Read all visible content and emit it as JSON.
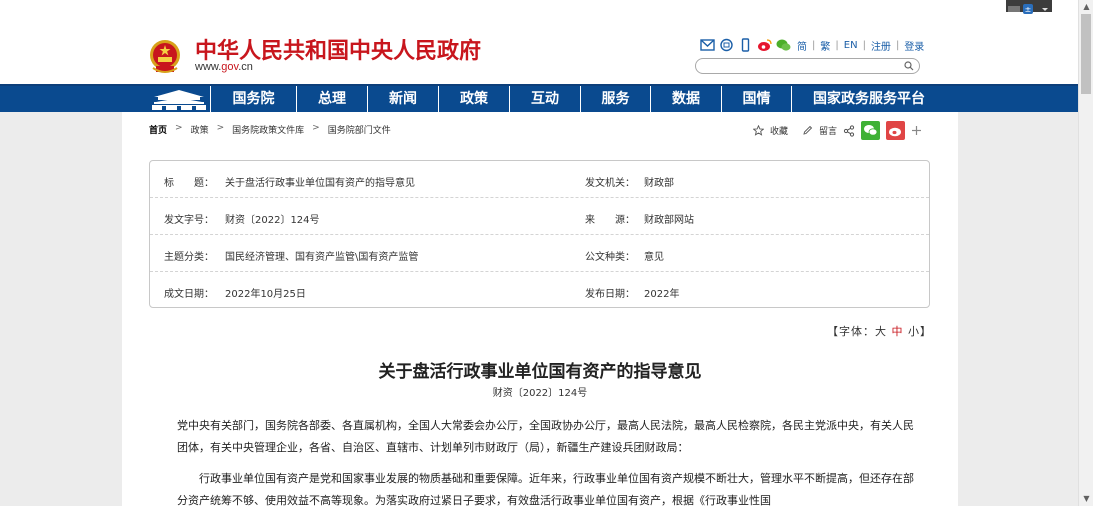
{
  "header": {
    "site_title": "中华人民共和国中央人民政府",
    "site_url_prefix": "www.",
    "site_url_brand": "gov",
    "site_url_suffix": ".cn",
    "top_icons": [
      "mail-icon",
      "site-map-icon",
      "mobile-icon",
      "weibo-icon",
      "wechat-icon"
    ],
    "lang_links": [
      "简",
      "繁",
      "EN",
      "注册",
      "登录"
    ],
    "search_placeholder": ""
  },
  "nav": {
    "items": [
      "国务院",
      "总理",
      "新闻",
      "政策",
      "互动",
      "服务",
      "数据",
      "国情",
      "国家政务服务平台"
    ]
  },
  "breadcrumb": [
    "首页",
    "政策",
    "国务院政策文件库",
    "国务院部门文件"
  ],
  "breadcrumb_sep": ">",
  "share": {
    "favorite": "收藏",
    "comment": "留言"
  },
  "meta": {
    "title_label": "标　　题：",
    "title_value": "关于盘活行政事业单位国有资产的指导意见",
    "issuer_label": "发文机关：",
    "issuer_value": "财政部",
    "docno_label": "发文字号：",
    "docno_value": "财资〔2022〕124号",
    "source_label": "来　　源：",
    "source_value": "财政部网站",
    "topic_label": "主题分类：",
    "topic_value": "国民经济管理、国有资产监管\\国有资产监管",
    "type_label": "公文种类：",
    "type_value": "意见",
    "date_label": "成文日期：",
    "date_value": "2022年10月25日",
    "pub_label": "发布日期：",
    "pub_value": "2022年"
  },
  "font_size": {
    "prefix": "【字体：",
    "large": "大",
    "medium": "中",
    "small": "小",
    "suffix": "】"
  },
  "article": {
    "title": "关于盘活行政事业单位国有资产的指导意见",
    "doc_number": "财资〔2022〕124号",
    "salutation": "党中央有关部门，国务院各部委、各直属机构，全国人大常委会办公厅，全国政协办公厅，最高人民法院，最高人民检察院，各民主党派中央，有关人民团体，有关中央管理企业，各省、自治区、直辖市、计划单列市财政厅（局），新疆生产建设兵团财政局：",
    "para1": "行政事业单位国有资产是党和国家事业发展的物质基础和重要保障。近年来，行政事业单位国有资产规模不断壮大，管理水平不断提高，但还存在部分资产统筹不够、使用效益不高等现象。为落实政府过紧日子要求，有效盘活行政事业单位国有资产，根据《行政事业性国"
  },
  "colors": {
    "brand_red": "#c8161d",
    "nav_blue": "#0a4a8f",
    "link_blue": "#1b5fa8"
  }
}
